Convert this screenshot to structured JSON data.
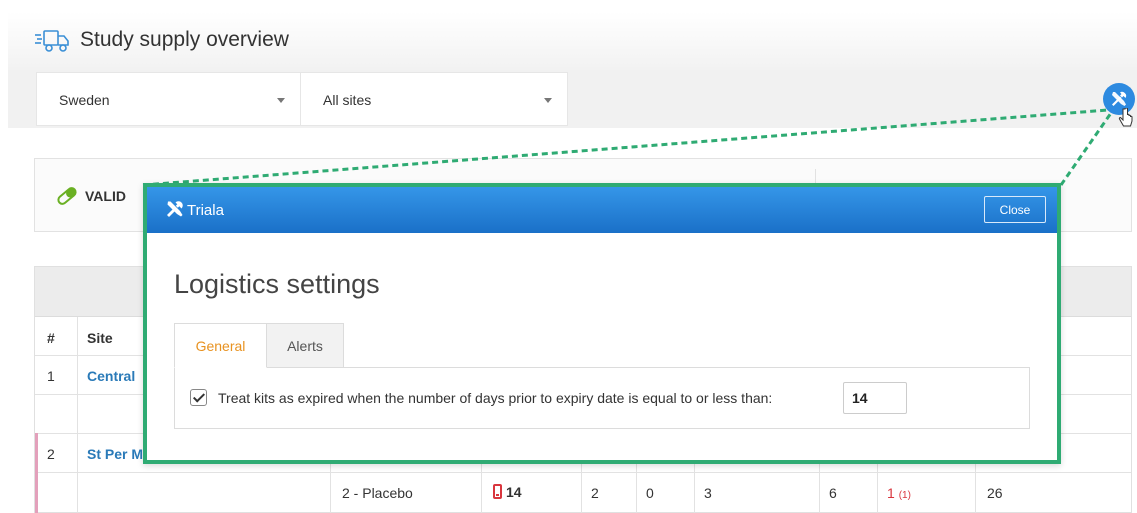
{
  "page": {
    "title": "Study supply overview"
  },
  "filters": {
    "country": "Sweden",
    "site": "All sites"
  },
  "status": {
    "valid_label": "VALID"
  },
  "table": {
    "headers": {
      "num": "#",
      "site": "Site"
    },
    "rows": [
      {
        "num": "1",
        "site": "Central"
      },
      {
        "num": "2",
        "site": "St Per M"
      }
    ],
    "visible_row": {
      "treatment": "2 - Placebo",
      "phone_value": "14",
      "c1": "2",
      "c2": "0",
      "c3": "3",
      "c4": "6",
      "alert_value": "1",
      "alert_sub": "(1)",
      "c5": "26"
    }
  },
  "modal": {
    "brand": "Triala",
    "close_label": "Close",
    "heading": "Logistics settings",
    "tabs": [
      {
        "label": "General",
        "active": true
      },
      {
        "label": "Alerts",
        "active": false
      }
    ],
    "setting": {
      "checked": true,
      "label": "Treat kits as expired when the number of days prior to expiry date is equal to or less than:",
      "value": "14"
    }
  },
  "colors": {
    "accent": "#2d8ae0",
    "modal_border": "#2fab73",
    "active_tab": "#e89220",
    "alert_red": "#d9363e"
  }
}
